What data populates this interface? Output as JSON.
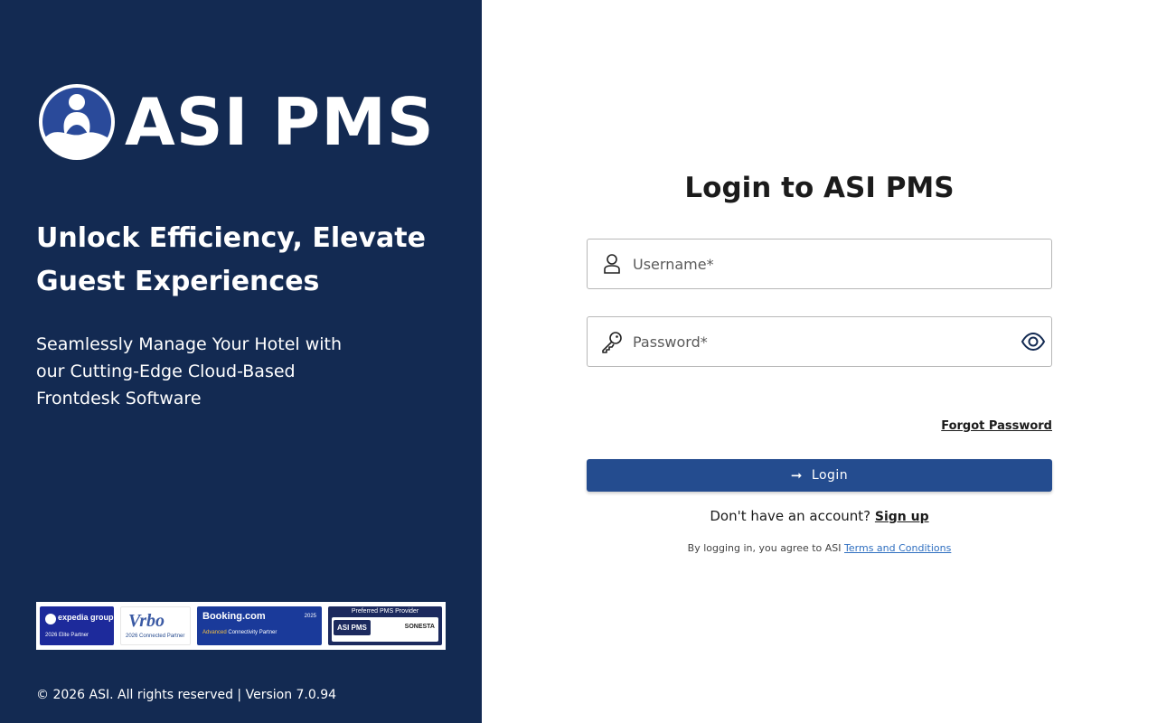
{
  "brand": {
    "name": "ASI PMS",
    "headline": "Unlock Efficiency, Elevate Guest Experiences",
    "subline": "Seamlessly Manage Your Hotel with our Cutting-Edge Cloud-Based Frontdesk Software",
    "footer": "© 2026 ASI. All rights reserved | Version 7.0.94",
    "colors": {
      "panel": "#132a52",
      "button": "#244c8f",
      "link": "#2f6fc0"
    }
  },
  "badges": {
    "expedia": {
      "name": "expedia group",
      "sub": "2026 Elite Partner"
    },
    "vrbo": {
      "name": "Vrbo",
      "sub": "2026 Connected Partner"
    },
    "booking": {
      "name": "Booking.com",
      "year": "2025",
      "sub_highlight": "Advanced",
      "sub_rest": " Connectivity Partner"
    },
    "preferred": {
      "top": "Preferred PMS Provider",
      "asi": "ASI PMS",
      "partner": "SONESTA"
    }
  },
  "form": {
    "title": "Login to ASI PMS",
    "username_placeholder": "Username*",
    "password_placeholder": "Password*",
    "forgot_label": "Forgot Password",
    "login_label": "Login",
    "signup_prompt": "Don't have an account?",
    "signup_label": " Sign up",
    "terms_prefix": "By logging in, you agree to ASI ",
    "terms_label": "Terms and Conditions"
  },
  "icons": {
    "logo": "asi-person-logo-icon",
    "user": "user-icon",
    "key": "key-icon",
    "eye": "eye-icon",
    "arrow": "arrow-right-icon"
  }
}
